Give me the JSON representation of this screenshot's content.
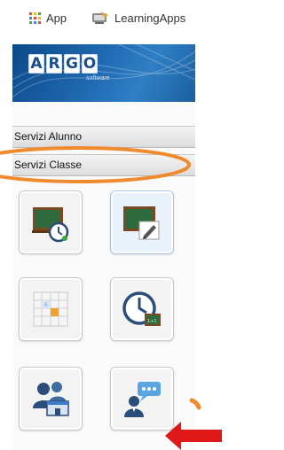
{
  "bookmarks": [
    {
      "label": "App",
      "icon": "apps-grid-icon"
    },
    {
      "label": "LearningApps",
      "icon": "learningapps-icon"
    }
  ],
  "banner": {
    "logo_letters": [
      "A",
      "R",
      "G",
      "O"
    ],
    "logo_sub": "software",
    "colors": {
      "dark": "#0b4a8a",
      "mid": "#1f69b0",
      "light": "#2f7fc4"
    }
  },
  "sections": {
    "alunno": "Servizi Alunno",
    "classe": "Servizi Classe"
  },
  "tiles": [
    {
      "icon": "chalkboard-clock-icon"
    },
    {
      "icon": "chalkboard-edit-icon",
      "selected": true
    },
    {
      "icon": "calendar-grid-icon"
    },
    {
      "icon": "clock-chalkboard-icon"
    },
    {
      "icon": "users-school-icon"
    },
    {
      "icon": "teacher-chat-icon"
    }
  ],
  "annotations": {
    "highlight_color": "#f08a2e",
    "arrow_color": "#e01818"
  }
}
